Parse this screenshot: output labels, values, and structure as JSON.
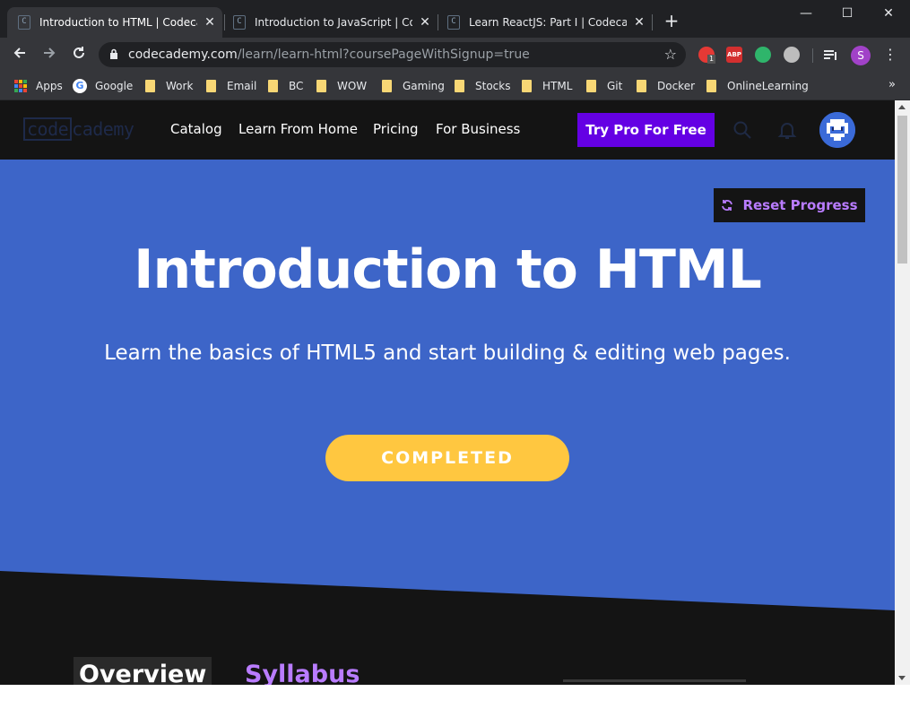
{
  "browser": {
    "tabs": [
      {
        "title": "Introduction to HTML | Codecademy",
        "active": true
      },
      {
        "title": "Introduction to JavaScript | Codecademy",
        "active": false
      },
      {
        "title": "Learn ReactJS: Part I | Codecademy",
        "active": false
      }
    ],
    "tab_favicon": "C",
    "tab_close": "✕",
    "new_tab": "+",
    "window_controls": {
      "minimize": "—",
      "maximize": "☐",
      "close": "✕"
    },
    "url_domain": "codecademy.com",
    "url_path": "/learn/learn-html?coursePageWithSignup=true",
    "profile_initial": "S",
    "extension_badge": "1",
    "extension_abp": "ABP",
    "bookmarks": [
      "Apps",
      "Google",
      "Work",
      "Email",
      "BC",
      "WOW",
      "Gaming",
      "Stocks",
      "HTML",
      "Git",
      "Docker",
      "OnlineLearning"
    ],
    "bookmarks_overflow": "»"
  },
  "site": {
    "logo_code": "code",
    "logo_cademy": "cademy",
    "nav": [
      "Catalog",
      "Learn From Home",
      "Pricing",
      "For Business"
    ],
    "cta_label": "Try Pro For Free"
  },
  "hero": {
    "reset_label": "Reset Progress",
    "title": "Introduction to HTML",
    "subtitle": "Learn the basics of HTML5 and start building & editing web pages.",
    "status_label": "COMPLETED"
  },
  "page_tabs": {
    "overview": "Overview",
    "syllabus": "Syllabus"
  },
  "colors": {
    "hero_blue": "#3d65c8",
    "cta_purple": "#6400e4",
    "completed_yellow": "#ffc740",
    "accent_lavender": "#b97cff"
  }
}
